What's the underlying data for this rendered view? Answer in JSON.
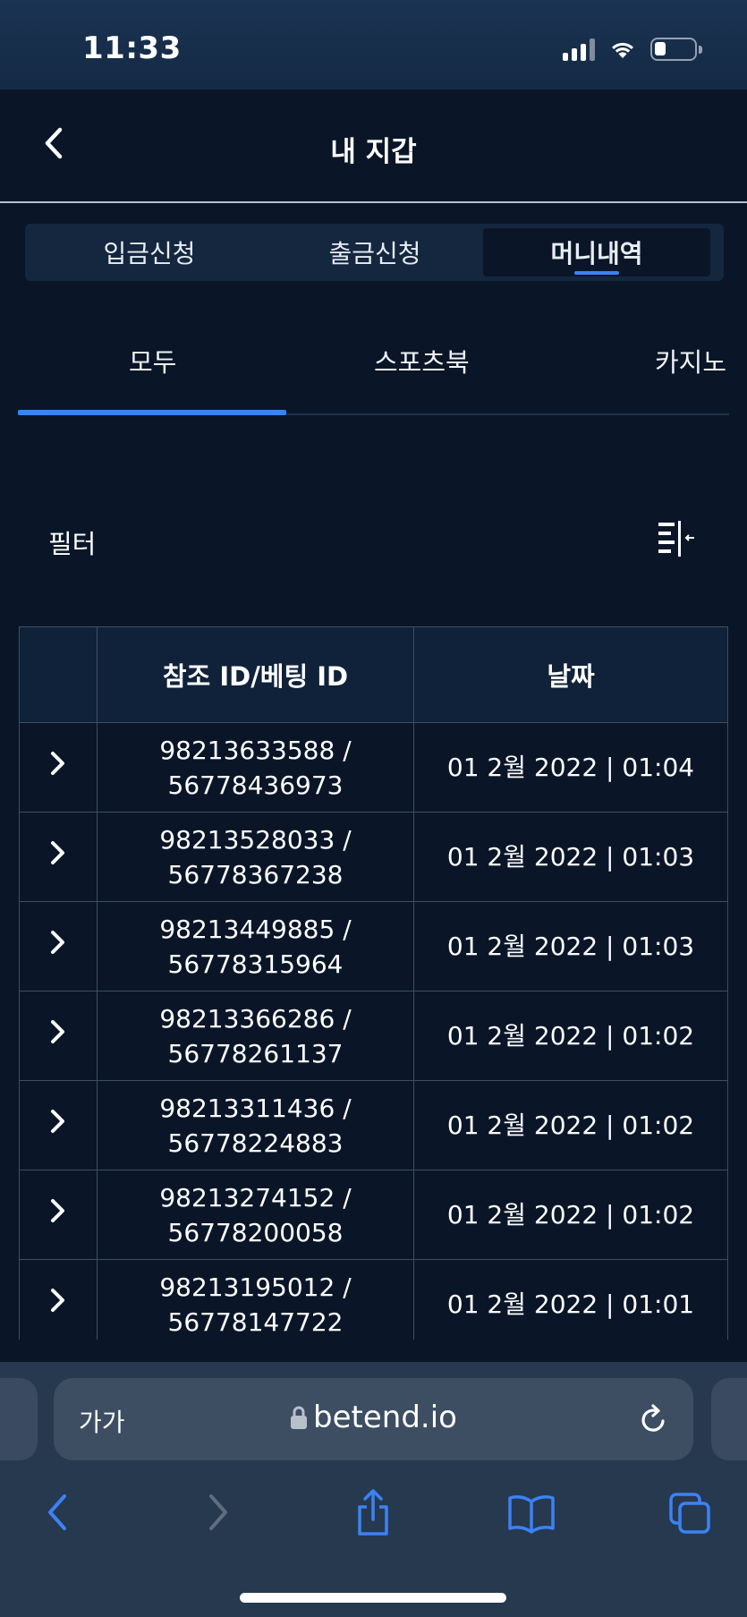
{
  "status_bar": {
    "time": "11:33"
  },
  "header": {
    "title": "내 지갑"
  },
  "segments": [
    {
      "label": "입금신청",
      "active": false
    },
    {
      "label": "출금신청",
      "active": false
    },
    {
      "label": "머니내역",
      "active": true
    }
  ],
  "category_tabs": [
    {
      "label": "모두",
      "active": true
    },
    {
      "label": "스포츠북",
      "active": false
    },
    {
      "label": "카지노",
      "active": false
    }
  ],
  "filter": {
    "label": "필터"
  },
  "table": {
    "headers": [
      "",
      "참조 ID/베팅 ID",
      "날짜"
    ],
    "rows": [
      {
        "ref_id": "98213633588 /",
        "bet_id": "56778436973",
        "date": "01 2월 2022 | 01:04"
      },
      {
        "ref_id": "98213528033 /",
        "bet_id": "56778367238",
        "date": "01 2월 2022 | 01:03"
      },
      {
        "ref_id": "98213449885 /",
        "bet_id": "56778315964",
        "date": "01 2월 2022 | 01:03"
      },
      {
        "ref_id": "98213366286 /",
        "bet_id": "56778261137",
        "date": "01 2월 2022 | 01:02"
      },
      {
        "ref_id": "98213311436 /",
        "bet_id": "56778224883",
        "date": "01 2월 2022 | 01:02"
      },
      {
        "ref_id": "98213274152 /",
        "bet_id": "56778200058",
        "date": "01 2월 2022 | 01:02"
      },
      {
        "ref_id": "98213195012 /",
        "bet_id": "56778147722",
        "date": "01 2월 2022 | 01:01"
      }
    ]
  },
  "browser": {
    "text_size_label": "가가",
    "url": "betend.io"
  },
  "colors": {
    "background": "#0a1628",
    "accent": "#3b82f6",
    "grid": "#3e4d63",
    "safari_bar": "#27394e"
  }
}
